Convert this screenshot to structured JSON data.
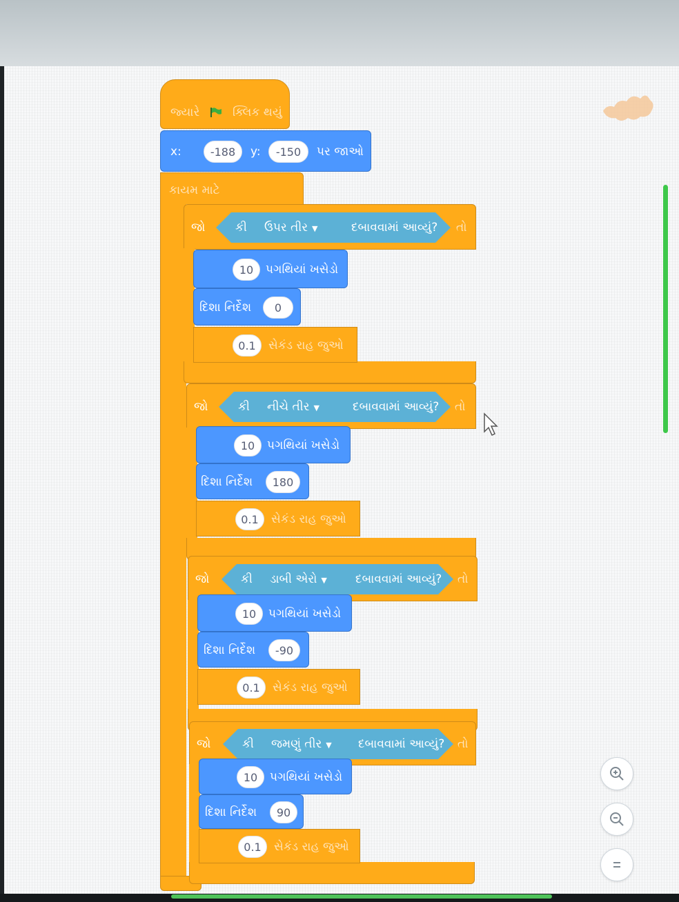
{
  "hat": {
    "when": "જ્યારે",
    "clicked": "ક્લિક થયું"
  },
  "goto": {
    "x_label": "x:",
    "x_value": "-188",
    "y_label": "y:",
    "y_value": "-150",
    "suffix": "પર જાઓ"
  },
  "forever": {
    "label": "કાયમ માટે"
  },
  "if_blocks": [
    {
      "if_label": "જો",
      "key_prefix": "કી",
      "key": "ઉપર તીર",
      "pressed": "દબાવવામાં આવ્યું?",
      "then": "તો",
      "move_steps": "10",
      "move_label": "પગથિયાં ખસેડો",
      "point_label": "દિશા નિર્દેશ",
      "direction": "0",
      "wait_value": "0.1",
      "wait_label": "સેકંડ રાહ જુઓ"
    },
    {
      "if_label": "જો",
      "key_prefix": "કી",
      "key": "નીચે તીર",
      "pressed": "દબાવવામાં આવ્યું?",
      "then": "તો",
      "move_steps": "10",
      "move_label": "પગથિયાં ખસેડો",
      "point_label": "દિશા નિર્દેશ",
      "direction": "180",
      "wait_value": "0.1",
      "wait_label": "સેકંડ રાહ જુઓ"
    },
    {
      "if_label": "જો",
      "key_prefix": "કી",
      "key": "ડાબી એરો",
      "pressed": "દબાવવામાં આવ્યું?",
      "then": "તો",
      "move_steps": "10",
      "move_label": "પગથિયાં ખસેડો",
      "point_label": "દિશા નિર્દેશ",
      "direction": "-90",
      "wait_value": "0.1",
      "wait_label": "સેકંડ રાહ જુઓ"
    },
    {
      "if_label": "જો",
      "key_prefix": "કી",
      "key": "જમણું તીર",
      "pressed": "દબાવવામાં આવ્યું?",
      "then": "તો",
      "move_steps": "10",
      "move_label": "પગથિયાં ખસેડો",
      "point_label": "દિશા નિર્દેશ",
      "direction": "90",
      "wait_value": "0.1",
      "wait_label": "સેકંડ રાહ જુઓ"
    }
  ],
  "zoom": {
    "in_icon": "zoom-in-icon",
    "out_icon": "zoom-out-icon",
    "reset_icon": "zoom-reset-icon"
  },
  "colors": {
    "events": "#ffab19",
    "motion": "#4c97ff",
    "sensing": "#5cb1d6",
    "control": "#ffab19"
  }
}
